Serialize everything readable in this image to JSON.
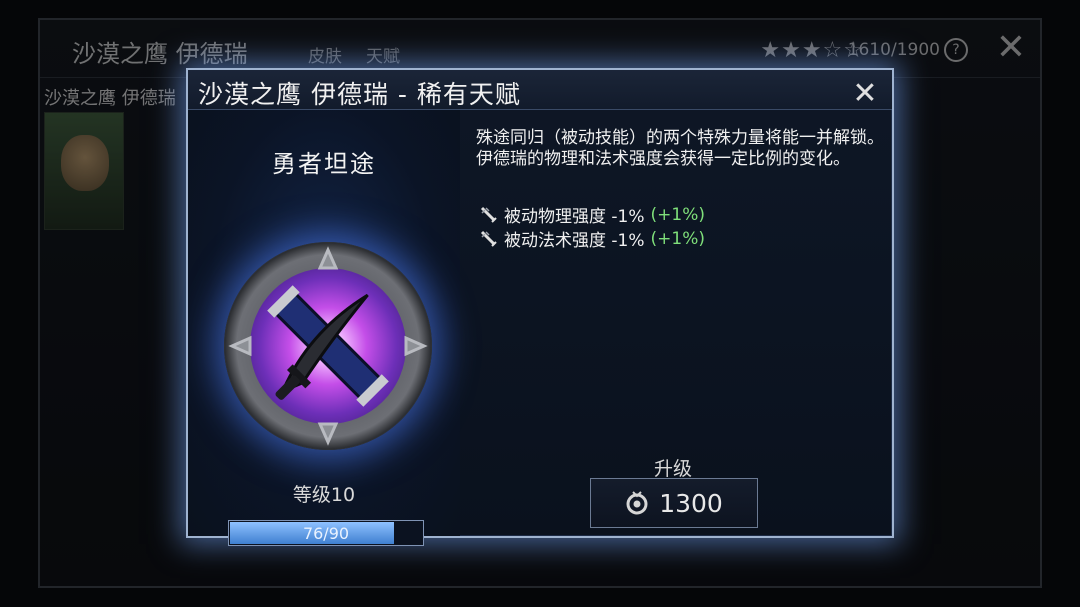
{
  "background": {
    "title": "沙漠之鹰 伊德瑞",
    "tabs": [
      "皮肤",
      "天赋"
    ],
    "stars": "★★★☆☆",
    "progress": "1610/1900",
    "help": "?",
    "close": "✕",
    "subtitle": "沙漠之鹰 伊德瑞"
  },
  "modal": {
    "title": "沙漠之鹰 伊德瑞 - 稀有天赋",
    "close": "✕",
    "talent_name": "勇者坦途",
    "level_label": "等级10",
    "xp": {
      "current": 76,
      "max": 90,
      "text": "76/90"
    },
    "description": "殊途同归（被动技能）的两个特殊力量将能一并解锁。 伊德瑞的物理和法术强度会获得一定比例的变化。",
    "stats": [
      {
        "label": "被动物理强度 -1%",
        "bonus": "(+1%)"
      },
      {
        "label": "被动法术强度 -1%",
        "bonus": "(+1%)"
      }
    ],
    "upgrade_label": "升级",
    "upgrade_cost": "1300"
  },
  "colors": {
    "accent": "#9fb3d0",
    "bonus": "#7fdf7a",
    "xp_fill": "#5a97e6"
  },
  "icons": {
    "stat": "sword-buff-icon",
    "currency": "talent-coin-icon",
    "emblem": "crossed-swords-emblem"
  }
}
